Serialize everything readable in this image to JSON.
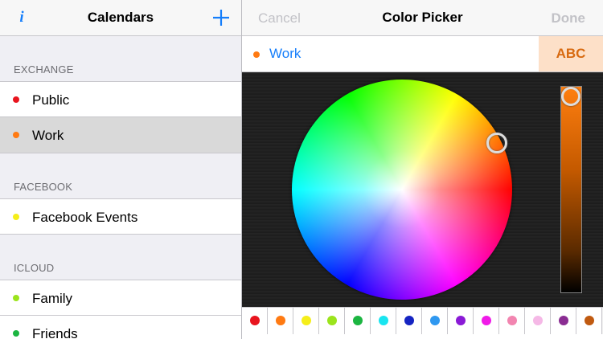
{
  "colors": {
    "accent": "#157efb",
    "selected_row": "#d9d9d9",
    "disabled_text": "#c2c2c7"
  },
  "left_panel": {
    "info_icon": "i",
    "title": "Calendars",
    "add_icon": "plus-icon",
    "sections": [
      {
        "header": "EXCHANGE",
        "items": [
          {
            "label": "Public",
            "color": "#e8141e"
          },
          {
            "label": "Work",
            "color": "#ff7a12",
            "selected": true
          }
        ]
      },
      {
        "header": "FACEBOOK",
        "items": [
          {
            "label": "Facebook Events",
            "color": "#f5ee1a"
          }
        ]
      },
      {
        "header": "ICLOUD",
        "items": [
          {
            "label": "Family",
            "color": "#9be41c"
          },
          {
            "label": "Friends",
            "color": "#1cb541"
          }
        ]
      }
    ]
  },
  "right_panel": {
    "cancel_label": "Cancel",
    "title": "Color Picker",
    "done_label": "Done",
    "calendar_name": "Work",
    "calendar_color": "#ff7a12",
    "preview_text": "ABC",
    "preview_text_color": "#d86a10",
    "preview_bg": "#fde0c8",
    "brightness": 1.0,
    "swatches": [
      "#e8141e",
      "#ff7a12",
      "#f5ee1a",
      "#9be41c",
      "#1cb541",
      "#19e5f0",
      "#1524c2",
      "#2f98f0",
      "#8a1ad6",
      "#f01ae8",
      "#f285b0",
      "#f5b8e6",
      "#8a2d92",
      "#c05a10"
    ]
  }
}
